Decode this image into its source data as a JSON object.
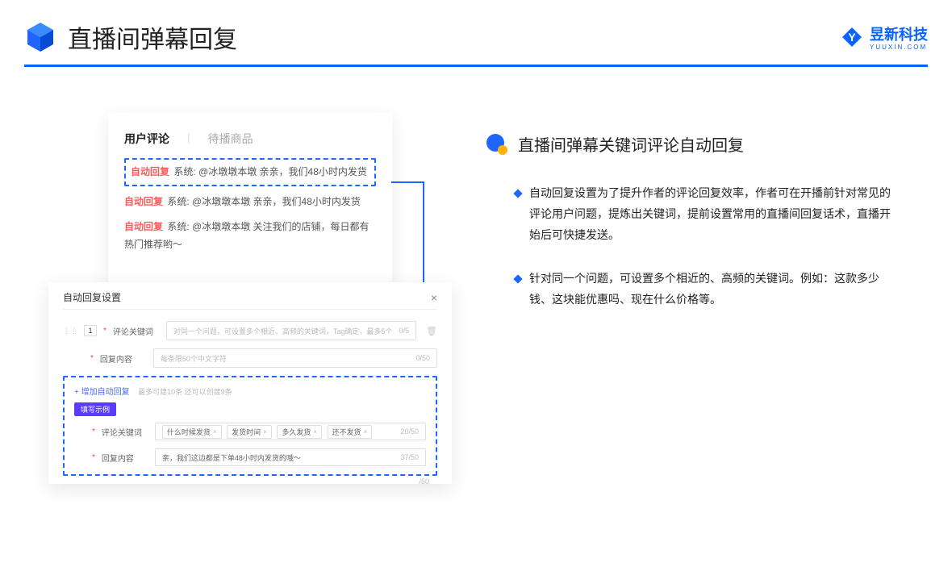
{
  "header": {
    "title": "直播间弹幕回复",
    "brand_name": "昱新科技",
    "brand_sub": "YUUXIN.COM"
  },
  "comments_card": {
    "tab_active": "用户评论",
    "tab_inactive": "待播商品",
    "rows": [
      {
        "tag": "自动回复",
        "text": "系统: @冰墩墩本墩 亲亲，我们48小时内发货"
      },
      {
        "tag": "自动回复",
        "text": "系统: @冰墩墩本墩 亲亲，我们48小时内发货"
      },
      {
        "tag": "自动回复",
        "text": "系统: @冰墩墩本墩 关注我们的店铺，每日都有热门推荐哟～"
      }
    ]
  },
  "settings_card": {
    "title": "自动回复设置",
    "index": "1",
    "keyword_label": "评论关键词",
    "keyword_placeholder": "对同一个问题，可设置多个相近、高频的关键词，Tag确定，最多5个",
    "keyword_count": "0/5",
    "content_label": "回复内容",
    "content_placeholder": "每条限50个中文字符",
    "content_count": "0/50",
    "add_link": "+ 增加自动回复",
    "add_hint": "最多可建10条 还可以创建9条",
    "example_title": "填写示例",
    "example_tags": [
      "什么时候发货",
      "发货时间",
      "多久发货",
      "还不发货"
    ],
    "example_kw_count": "20/50",
    "example_content": "亲，我们这边都是下单48小时内发货的哦～",
    "example_content_count": "37/50",
    "outer_count": "/50"
  },
  "right": {
    "feature_title": "直播间弹幕关键词评论自动回复",
    "bullets": [
      "自动回复设置为了提升作者的评论回复效率，作者可在开播前针对常见的评论用户问题，提炼出关键词，提前设置常用的直播间回复话术，直播开始后可快捷发送。",
      "针对同一个问题，可设置多个相近的、高频的关键词。例如：这款多少钱、这块能优惠吗、现在什么价格等。"
    ]
  }
}
